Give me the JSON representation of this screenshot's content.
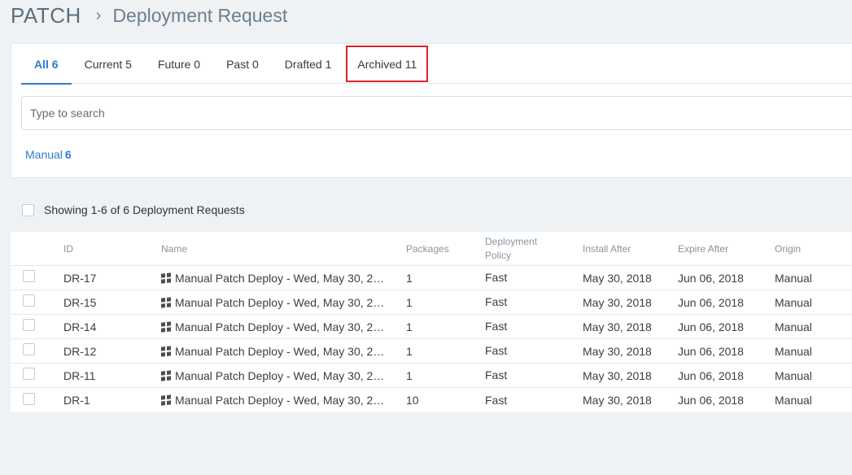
{
  "breadcrumb": {
    "root": "PATCH",
    "separator": "›",
    "current": "Deployment Request"
  },
  "tabs": [
    {
      "label": "All 6",
      "active": true
    },
    {
      "label": "Current 5",
      "active": false
    },
    {
      "label": "Future 0",
      "active": false
    },
    {
      "label": "Past 0",
      "active": false
    },
    {
      "label": "Drafted 1",
      "active": false
    },
    {
      "label": "Archived 11",
      "active": false,
      "highlighted": true
    }
  ],
  "search": {
    "placeholder": "Type to search",
    "value": ""
  },
  "facet": {
    "label": "Manual",
    "count": "6"
  },
  "showing": {
    "text": "Showing 1-6 of 6 Deployment Requests"
  },
  "table": {
    "headers": {
      "id": "ID",
      "name": "Name",
      "packages": "Packages",
      "policy_line1": "Deployment",
      "policy_line2": "Policy",
      "install_after": "Install After",
      "expire_after": "Expire After",
      "origin": "Origin"
    },
    "rows": [
      {
        "id": "DR-17",
        "name": "Manual Patch Deploy - Wed, May 30, 2…",
        "packages": "1",
        "policy": "Fast",
        "install_after": "May 30, 2018",
        "expire_after": "Jun 06, 2018",
        "origin": "Manual"
      },
      {
        "id": "DR-15",
        "name": "Manual Patch Deploy - Wed, May 30, 2…",
        "packages": "1",
        "policy": "Fast",
        "install_after": "May 30, 2018",
        "expire_after": "Jun 06, 2018",
        "origin": "Manual"
      },
      {
        "id": "DR-14",
        "name": "Manual Patch Deploy - Wed, May 30, 2…",
        "packages": "1",
        "policy": "Fast",
        "install_after": "May 30, 2018",
        "expire_after": "Jun 06, 2018",
        "origin": "Manual"
      },
      {
        "id": "DR-12",
        "name": "Manual Patch Deploy - Wed, May 30, 2…",
        "packages": "1",
        "policy": "Fast",
        "install_after": "May 30, 2018",
        "expire_after": "Jun 06, 2018",
        "origin": "Manual"
      },
      {
        "id": "DR-11",
        "name": "Manual Patch Deploy - Wed, May 30, 2…",
        "packages": "1",
        "policy": "Fast",
        "install_after": "May 30, 2018",
        "expire_after": "Jun 06, 2018",
        "origin": "Manual"
      },
      {
        "id": "DR-1",
        "name": "Manual Patch Deploy - Wed, May 30, 2…",
        "packages": "10",
        "policy": "Fast",
        "install_after": "May 30, 2018",
        "expire_after": "Jun 06, 2018",
        "origin": "Manual"
      }
    ]
  },
  "colors": {
    "accent": "#2e7ad1",
    "highlight_box": "#d9232d",
    "background": "#eef2f5"
  },
  "icons": {
    "row_os": "windows-icon"
  }
}
